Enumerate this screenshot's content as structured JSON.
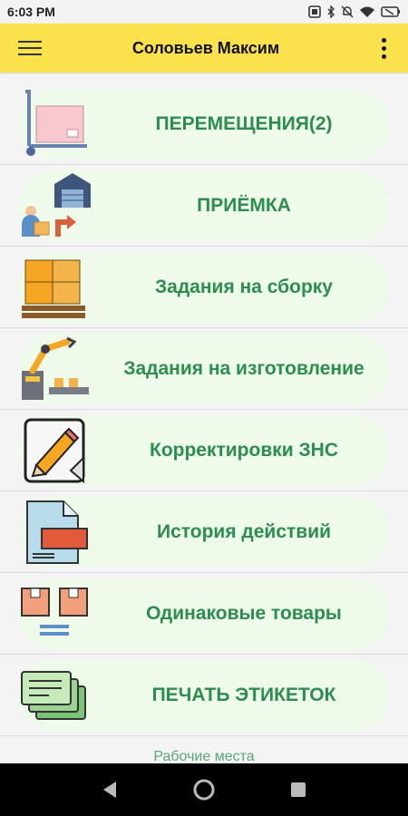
{
  "status": {
    "time": "6:03 PM"
  },
  "header": {
    "title": "Соловьев Максим"
  },
  "menu": [
    {
      "label": "ПЕРЕМЕЩЕНИЯ(2)",
      "icon": "hand-truck-icon"
    },
    {
      "label": "ПРИЁМКА",
      "icon": "warehouse-receive-icon"
    },
    {
      "label": "Задания на сборку",
      "icon": "boxes-pallet-icon"
    },
    {
      "label": "Задания на изготовление",
      "icon": "robot-arm-icon"
    },
    {
      "label": "Корректировки ЗНС",
      "icon": "pencil-paper-icon"
    },
    {
      "label": "История действий",
      "icon": "log-file-icon"
    },
    {
      "label": "Одинаковые товары",
      "icon": "identical-boxes-icon"
    },
    {
      "label": "ПЕЧАТЬ ЭТИКЕТОК",
      "icon": "labels-stack-icon"
    }
  ],
  "footer": {
    "link": "Рабочие места"
  },
  "colors": {
    "app_bar": "#fbe24d",
    "pill_bg": "#eefbea",
    "label_green": "#2c8d4e"
  }
}
